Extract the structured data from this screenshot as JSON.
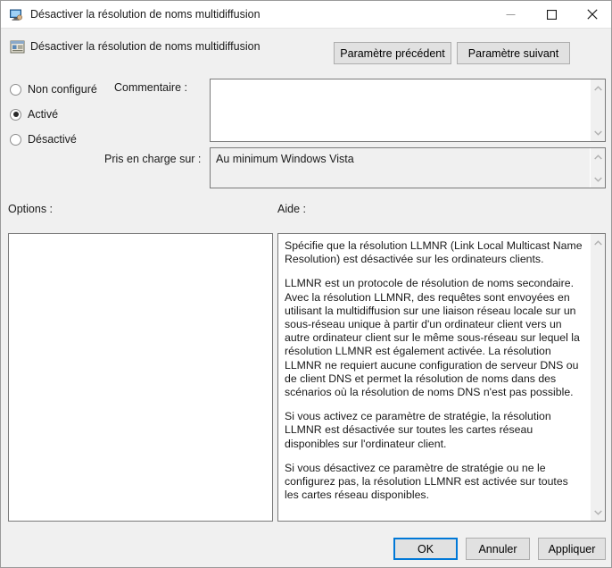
{
  "window": {
    "title": "Désactiver la résolution de noms multidiffusion",
    "title_icon": "computer-monitor-icon",
    "controls": {
      "minimize": "minimize-icon",
      "maximize": "maximize-icon",
      "close": "close-icon"
    }
  },
  "header": {
    "icon": "policy-setting-icon",
    "title": "Désactiver la résolution de noms multidiffusion",
    "prev_button": "Paramètre précédent",
    "next_button": "Paramètre suivant"
  },
  "state_options": {
    "items": [
      {
        "label": "Non configuré",
        "selected": false
      },
      {
        "label": "Activé",
        "selected": true
      },
      {
        "label": "Désactivé",
        "selected": false
      }
    ]
  },
  "fields": {
    "comment_label": "Commentaire :",
    "comment_value": "",
    "supported_label": "Pris en charge sur :",
    "supported_value": "Au minimum Windows Vista"
  },
  "panels": {
    "options_label": "Options :",
    "help_label": "Aide :",
    "options_content": "",
    "help_paragraphs": [
      "Spécifie que la résolution LLMNR (Link Local Multicast Name Resolution) est désactivée sur les ordinateurs clients.",
      "LLMNR est un protocole de résolution de noms secondaire. Avec la résolution LLMNR, des requêtes sont envoyées en utilisant la multidiffusion sur une liaison réseau locale sur un sous-réseau unique à partir d'un ordinateur client vers un autre ordinateur client sur le même sous-réseau sur lequel la résolution LLMNR est également activée. La résolution LLMNR ne requiert aucune configuration de serveur DNS ou de client DNS et permet la résolution de noms dans des scénarios où la résolution de noms DNS n'est pas possible.",
      "Si vous activez ce paramètre de stratégie, la résolution LLMNR est désactivée sur toutes les cartes réseau disponibles sur l'ordinateur client.",
      "Si vous désactivez ce paramètre de stratégie ou ne le configurez pas, la résolution LLMNR est activée sur toutes les cartes réseau disponibles."
    ]
  },
  "footer": {
    "ok": "OK",
    "cancel": "Annuler",
    "apply": "Appliquer"
  },
  "colors": {
    "dialog_background": "#f0f0f0",
    "focus_accent": "#0078d7",
    "field_background": "#ffffff",
    "border": "#7a7a7a",
    "button_face": "#e1e1e1"
  }
}
